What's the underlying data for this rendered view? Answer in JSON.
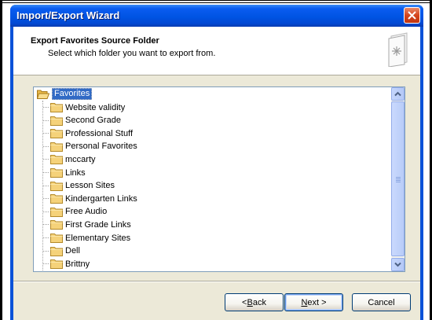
{
  "window": {
    "title": "Import/Export Wizard"
  },
  "header": {
    "title": "Export Favorites Source Folder",
    "subtitle": "Select which folder you want to export from."
  },
  "tree": {
    "root": "Favorites",
    "items": [
      "Website validity",
      "Second Grade",
      "Professional Stuff",
      "Personal Favorites",
      "mccarty",
      "Links",
      "Lesson Sites",
      "Kindergarten Links",
      "Free Audio",
      "First Grade Links",
      "Elementary Sites",
      "Dell",
      "Brittny"
    ]
  },
  "buttons": {
    "back_underlined": "B",
    "back_rest": "ack",
    "back_prefix": "< ",
    "next_underlined": "N",
    "next_rest": "ext >",
    "cancel": "Cancel"
  },
  "colors": {
    "titlebar": "#0054e3",
    "selection": "#316ac5",
    "folder": "#f5d27a"
  },
  "icons": {
    "close": "close-icon",
    "wizard": "favorites-book-icon",
    "folder": "folder-icon",
    "scroll_up": "chevron-up-icon",
    "scroll_down": "chevron-down-icon"
  }
}
